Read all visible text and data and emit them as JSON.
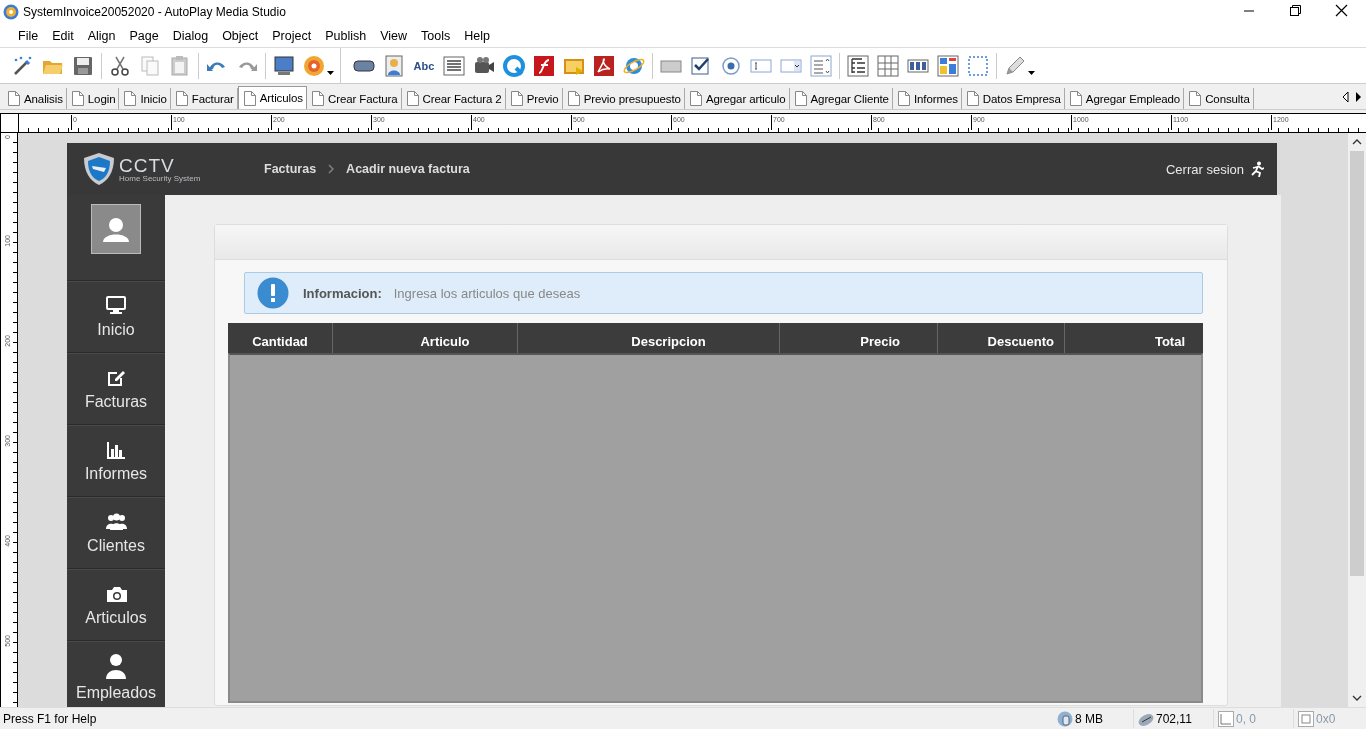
{
  "window": {
    "title": "SystemInvoice20052020 - AutoPlay Media Studio"
  },
  "menu": [
    "File",
    "Edit",
    "Align",
    "Page",
    "Dialog",
    "Object",
    "Project",
    "Publish",
    "View",
    "Tools",
    "Help"
  ],
  "toolbar": {
    "text_icon": "Abc"
  },
  "page_tabs": [
    {
      "label": "Analisis",
      "selected": false
    },
    {
      "label": "Login",
      "selected": false
    },
    {
      "label": "Inicio",
      "selected": false
    },
    {
      "label": "Facturar",
      "selected": false
    },
    {
      "label": "Articulos",
      "selected": true
    },
    {
      "label": "Crear Factura",
      "selected": false
    },
    {
      "label": "Crear Factura 2",
      "selected": false
    },
    {
      "label": "Previo",
      "selected": false
    },
    {
      "label": "Previo presupuesto",
      "selected": false
    },
    {
      "label": "Agregar articulo",
      "selected": false
    },
    {
      "label": "Agregar Cliente",
      "selected": false
    },
    {
      "label": "Informes",
      "selected": false
    },
    {
      "label": "Datos Empresa",
      "selected": false
    },
    {
      "label": "Agregar Empleado",
      "selected": false
    },
    {
      "label": "Consulta",
      "selected": false
    }
  ],
  "ruler": {
    "horizontal": [
      "0",
      "100",
      "200",
      "300",
      "400",
      "500",
      "600",
      "700",
      "800",
      "900",
      "1000",
      "1100",
      "1200"
    ],
    "vertical": [
      "0",
      "100",
      "200",
      "300",
      "400",
      "500"
    ]
  },
  "page": {
    "header": {
      "logo_title": "CCTV",
      "logo_subtitle": "Home Security System",
      "breadcrumb": [
        "Facturas",
        "Acadir nueva factura"
      ],
      "logout": "Cerrar sesion"
    },
    "sidebar": [
      {
        "label": "Inicio"
      },
      {
        "label": "Facturas"
      },
      {
        "label": "Informes"
      },
      {
        "label": "Clientes"
      },
      {
        "label": "Articulos"
      },
      {
        "label": "Empleados"
      }
    ],
    "alert": {
      "title": "Informacion:",
      "message": "Ingresa los articulos que deseas"
    },
    "table": {
      "columns": [
        "Cantidad",
        "Articulo",
        "Descripcion",
        "Precio",
        "Descuento",
        "Total"
      ]
    }
  },
  "status_bar": {
    "help": "Press F1 for Help",
    "memory": "8 MB",
    "cursor": "702,11",
    "position": "0, 0",
    "size": "0x0"
  }
}
